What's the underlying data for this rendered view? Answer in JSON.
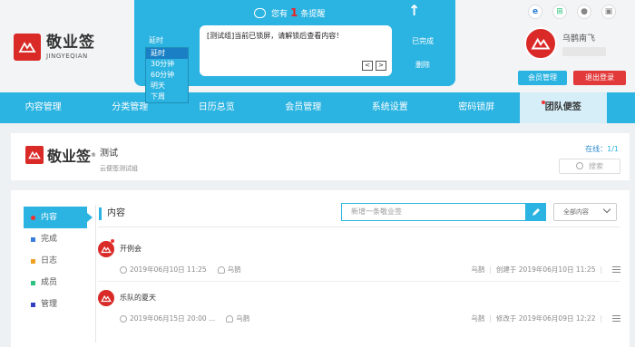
{
  "app": {
    "name_cn": "敬业签",
    "name_en": "JINGYEQIAN"
  },
  "reminder": {
    "title_prefix": "您有",
    "count": "1",
    "title_suffix": "条提醒",
    "message": "[测试组]当前已锁屏，请解锁后查看内容！",
    "prev": "<",
    "next": ">",
    "done_label": "已完成",
    "delete_label": "删除",
    "delay_label": "延时",
    "delay_options": [
      "延时",
      "30分钟",
      "60分钟",
      "明天",
      "下周"
    ],
    "delay_selected": "延时"
  },
  "user": {
    "name": "乌鹊南飞",
    "member_button": "会员管理",
    "logout_button": "退出登录",
    "os_icons": [
      "ie-icon",
      "windows-icon",
      "apple-icon",
      "android-icon"
    ]
  },
  "nav": {
    "items": [
      "内容管理",
      "分类管理",
      "日历总览",
      "会员管理",
      "系统设置",
      "密码锁屏",
      "团队便签"
    ],
    "active": "团队便签"
  },
  "group": {
    "logo_text": "敬业签",
    "reg_mark": "®",
    "name": "测试",
    "desc": "云便签测试组",
    "online_label": "在线：",
    "online_value": "1/1",
    "search_placeholder": "搜索"
  },
  "sidebar": {
    "items": [
      {
        "label": "内容",
        "color": "#e33"
      },
      {
        "label": "完成",
        "color": "#3a7be0"
      },
      {
        "label": "日志",
        "color": "#f0a020"
      },
      {
        "label": "成员",
        "color": "#2ec27e"
      },
      {
        "label": "管理",
        "color": "#3040c0"
      }
    ]
  },
  "content": {
    "title": "内容",
    "new_placeholder": "新增一条敬业签",
    "filter_label": "全部内容",
    "rows": [
      {
        "title": "开例会",
        "time": "2019年06月10日 11:25",
        "assignee": "乌鹊",
        "author": "乌鹊",
        "action": "创建于 2019年06月10日 11:25"
      },
      {
        "title": "乐队的夏天",
        "time": "2019年06月15日 20:00 ...",
        "assignee": "乌鹊",
        "author": "乌鹊",
        "action": "修改于 2019年06月09日 12:22"
      }
    ]
  },
  "colors": {
    "accent": "#2bb3e1",
    "brand_red": "#d92a28",
    "logout_red": "#e23a3a"
  }
}
